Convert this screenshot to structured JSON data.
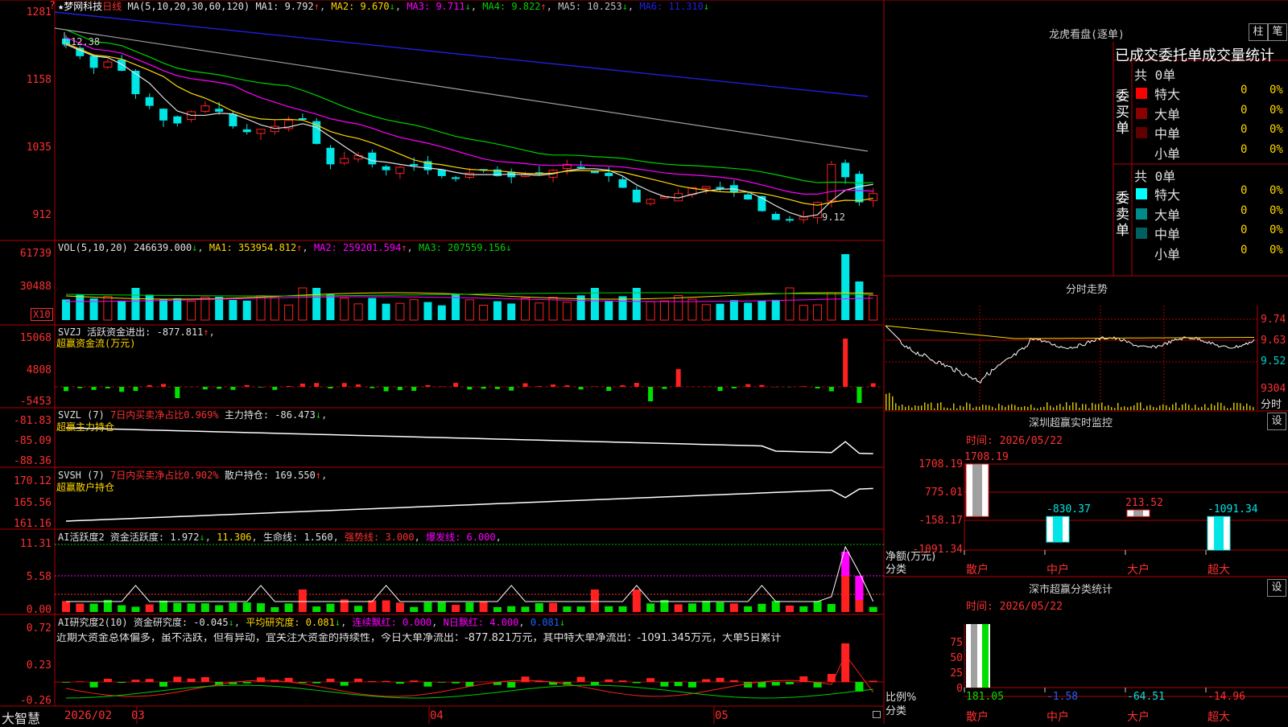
{
  "colors": {
    "up": "#ff2020",
    "down": "#00e5e5",
    "grid": "#b40000",
    "ma1": "#e0e0e0",
    "ma2": "#ffd700",
    "ma3": "#ff00ff",
    "ma4": "#00d000",
    "ma5": "#a0a0a0",
    "ma6": "#2020e0"
  },
  "top_icon": "?",
  "price_chart": {
    "title": "梦网科技",
    "period": "日线",
    "ma_params": "MA(5,10,20,30,60,120)",
    "ma1": "MA1: 9.792",
    "ma2": "MA2: 9.670",
    "ma3": "MA3: 9.711",
    "ma4": "MA4: 9.822",
    "ma5": "MA5: 10.253",
    "ma6": "MA6: 11.310",
    "y_ticks": [
      "1281",
      "1158",
      "1035",
      "912"
    ],
    "high_label": "12.38",
    "low_label": "9.12"
  },
  "vol_panel": {
    "name": "VOL(5,10,20)",
    "value": "246639.000",
    "ma1": "MA1: 353954.812",
    "ma2": "MA2: 259201.594",
    "ma3": "MA3: 207559.156",
    "y_ticks": [
      "61739",
      "30488"
    ],
    "unit": "X10"
  },
  "svzj_panel": {
    "name": "SVZJ",
    "label": "活跃资金进出: -877.811",
    "subtitle": "超赢资金流(万元)",
    "y_ticks": [
      "15068",
      "4808",
      "-5453"
    ]
  },
  "svzl_panel": {
    "name": "SVZL (7)",
    "pct": "7日内买卖净占比0.969%",
    "label": "主力持仓: -86.473",
    "subtitle": "超赢主力持仓",
    "y_ticks": [
      "-81.83",
      "-85.09",
      "-88.36"
    ]
  },
  "svsh_panel": {
    "name": "SVSH (7)",
    "pct": "7日内买卖净占比0.902%",
    "label": "散户持仓: 169.550",
    "subtitle": "超赢散户持仓",
    "y_ticks": [
      "170.12",
      "165.56",
      "161.16"
    ]
  },
  "ai_active_panel": {
    "name": "AI活跃度2",
    "label": "资金活跃度: 1.972",
    "v2": "11.306",
    "life": "生命线: 1.560",
    "strong": "强势线: 3.000",
    "burst": "爆发线: 6.000",
    "y_ticks": [
      "11.31",
      "5.58",
      "0.00"
    ]
  },
  "ai_research_panel": {
    "name": "AI研究度2(10)",
    "label": "资金研究度: -0.045",
    "avg": "平均研究度: 0.081",
    "red": "连续飘红: 0.000",
    "nred": "N日飘红: 4.000",
    "v": "0.081",
    "text": "近期大资金总体偏多，虽不活跃，但有异动，宜关注大资金的持续性，今日大单净流出：-877.821万元，其中特大单净流出：-1091.345万元，大单5日累计",
    "y_ticks": [
      "0.72",
      "0.23",
      "-0.26"
    ]
  },
  "bottom_axis": {
    "logo": "大智慧",
    "dates": [
      "2026/02",
      "03",
      "04",
      "05"
    ]
  },
  "dragon_panel": {
    "title": "龙虎看盘(逐单)",
    "btn1": "柱",
    "btn2": "笔",
    "header": "已成交委托单成交量统计",
    "buy_label": "委买单",
    "sell_label": "委卖单",
    "buy_total": "共 0单",
    "sell_total": "共 0单",
    "buy_rows": [
      {
        "name": "特大",
        "v": "0",
        "p": "0%",
        "color": "#ff0000"
      },
      {
        "name": "大单",
        "v": "0",
        "p": "0%",
        "color": "#8b0000"
      },
      {
        "name": "中单",
        "v": "0",
        "p": "0%",
        "color": "#600000"
      },
      {
        "name": "小单",
        "v": "0",
        "p": "0%",
        "color": "#000000"
      }
    ],
    "sell_rows": [
      {
        "name": "特大",
        "v": "0",
        "p": "0%",
        "color": "#00ffff"
      },
      {
        "name": "大单",
        "v": "0",
        "p": "0%",
        "color": "#008b8b"
      },
      {
        "name": "中单",
        "v": "0",
        "p": "0%",
        "color": "#006060"
      },
      {
        "name": "小单",
        "v": "0",
        "p": "0%",
        "color": "#000000"
      }
    ]
  },
  "intraday_panel": {
    "title": "分时走势",
    "y_ticks": [
      "9.74",
      "9.63",
      "9.52"
    ],
    "vol_tick": "9304",
    "vol_label": "分时"
  },
  "monitor_panel": {
    "title": "深圳超赢实时监控",
    "btn": "设",
    "time": "时间: 2026/05/22",
    "y_ticks": [
      "1708.19",
      "775.01",
      "-158.17",
      "-1091.34"
    ],
    "axis_label1": "净额(万元)",
    "axis_label2": "分类",
    "categories": [
      "散户",
      "中户",
      "大户",
      "超大"
    ],
    "values_text": [
      "1708.19",
      "-830.37",
      "213.52",
      "-1091.34"
    ],
    "chart_data": {
      "type": "bar",
      "categories": [
        "散户",
        "中户",
        "大户",
        "超大"
      ],
      "values": [
        1708.19,
        -830.37,
        213.52,
        -1091.34
      ],
      "ylim": [
        -1091.34,
        1708.19
      ]
    }
  },
  "class_panel": {
    "title": "深市超赢分类统计",
    "btn": "设",
    "time": "时间: 2026/05/22",
    "y_ticks": [
      "75",
      "50",
      "25",
      "0"
    ],
    "axis_label1": "比例%",
    "axis_label2": "分类",
    "categories": [
      "散户",
      "中户",
      "大户",
      "超大"
    ],
    "values_text": [
      "181.05",
      "-1.58",
      "-64.51",
      "-14.96"
    ],
    "chart_data": {
      "type": "bar",
      "categories": [
        "散户",
        "中户",
        "大户",
        "超大"
      ],
      "values": [
        181.05,
        -1.58,
        -64.51,
        -14.96
      ],
      "ylim": [
        0,
        100
      ]
    }
  }
}
